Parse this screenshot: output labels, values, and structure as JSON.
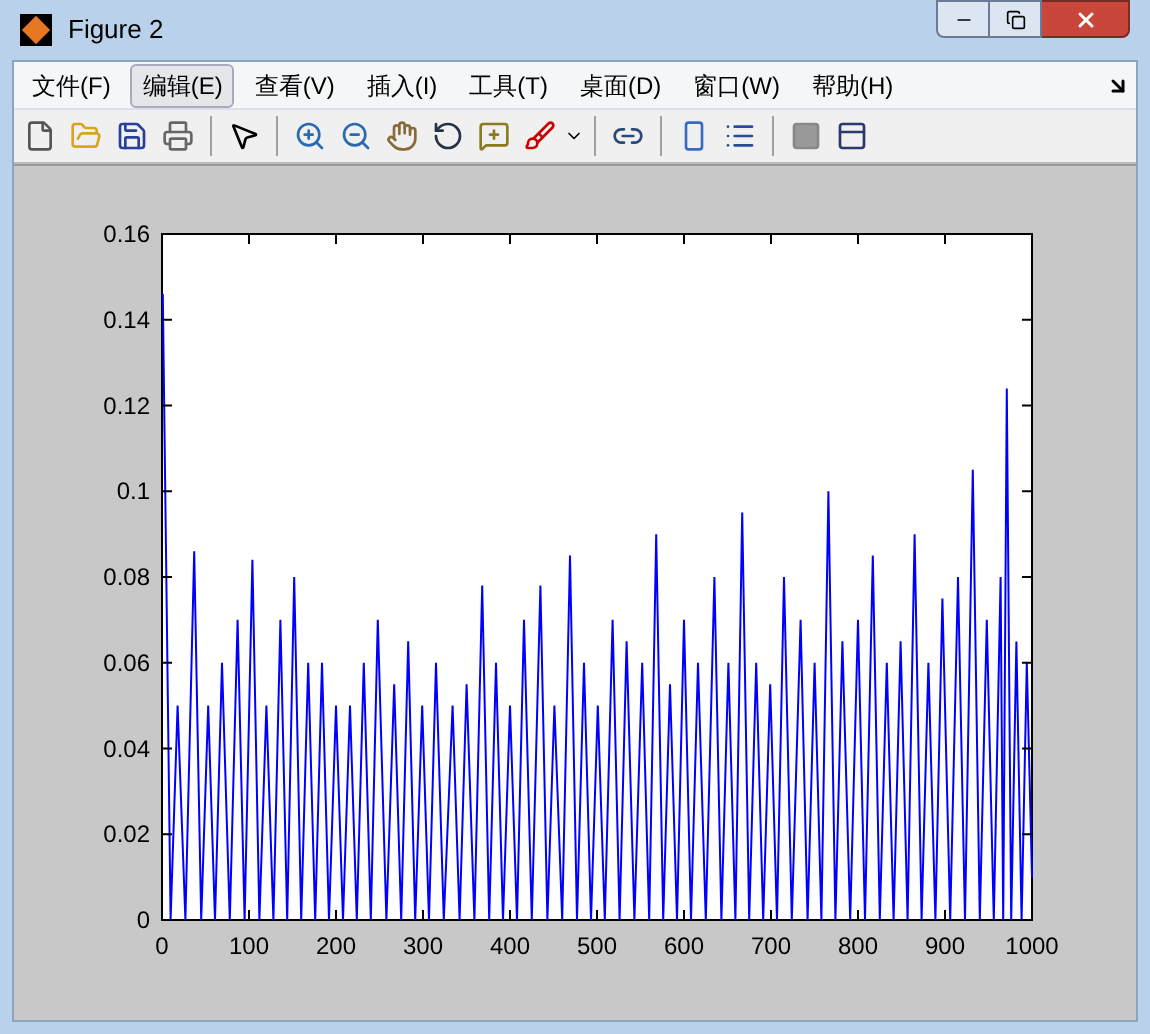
{
  "window": {
    "title": "Figure 2"
  },
  "menu": [
    {
      "label": "文件(F)",
      "selected": false
    },
    {
      "label": "编辑(E)",
      "selected": true
    },
    {
      "label": "查看(V)",
      "selected": false
    },
    {
      "label": "插入(I)",
      "selected": false
    },
    {
      "label": "工具(T)",
      "selected": false
    },
    {
      "label": "桌面(D)",
      "selected": false
    },
    {
      "label": "窗口(W)",
      "selected": false
    },
    {
      "label": "帮助(H)",
      "selected": false
    }
  ],
  "chart_data": {
    "type": "line",
    "xlim": [
      0,
      1000
    ],
    "ylim": [
      0,
      0.16
    ],
    "xticks": [
      0,
      100,
      200,
      300,
      400,
      500,
      600,
      700,
      800,
      900,
      1000
    ],
    "yticks": [
      0,
      0.02,
      0.04,
      0.06,
      0.08,
      0.1,
      0.12,
      0.14,
      0.16
    ],
    "x": [
      1,
      10,
      18,
      27,
      37,
      45,
      53,
      61,
      69,
      78,
      87,
      95,
      104,
      112,
      120,
      128,
      136,
      144,
      152,
      160,
      168,
      176,
      184,
      192,
      200,
      208,
      216,
      224,
      232,
      240,
      248,
      258,
      267,
      275,
      283,
      291,
      299,
      307,
      315,
      324,
      334,
      342,
      350,
      359,
      368,
      376,
      384,
      392,
      400,
      408,
      416,
      425,
      435,
      443,
      451,
      460,
      469,
      477,
      485,
      493,
      501,
      509,
      518,
      526,
      534,
      543,
      552,
      560,
      568,
      576,
      584,
      592,
      600,
      608,
      616,
      625,
      635,
      643,
      651,
      659,
      667,
      675,
      683,
      691,
      699,
      707,
      715,
      724,
      734,
      742,
      750,
      758,
      766,
      774,
      782,
      791,
      800,
      808,
      817,
      825,
      833,
      841,
      849,
      857,
      865,
      873,
      881,
      889,
      897,
      906,
      915,
      923,
      932,
      940,
      948,
      956,
      964,
      967,
      971,
      976,
      982,
      988,
      994,
      1000
    ],
    "series": [
      {
        "color": "#0000ff",
        "values": [
          0.146,
          0,
          0.05,
          0,
          0.086,
          0,
          0.05,
          0,
          0.06,
          0,
          0.07,
          0,
          0.084,
          0,
          0.05,
          0,
          0.07,
          0,
          0.08,
          0,
          0.06,
          0,
          0.06,
          0,
          0.05,
          0,
          0.05,
          0,
          0.06,
          0,
          0.07,
          0,
          0.055,
          0,
          0.065,
          0,
          0.05,
          0,
          0.06,
          0,
          0.05,
          0,
          0.055,
          0,
          0.078,
          0,
          0.06,
          0,
          0.05,
          0,
          0.07,
          0,
          0.078,
          0,
          0.05,
          0,
          0.085,
          0,
          0.06,
          0,
          0.05,
          0,
          0.07,
          0,
          0.065,
          0,
          0.06,
          0,
          0.09,
          0,
          0.055,
          0,
          0.07,
          0,
          0.06,
          0,
          0.08,
          0,
          0.06,
          0,
          0.095,
          0,
          0.06,
          0,
          0.055,
          0,
          0.08,
          0,
          0.07,
          0,
          0.06,
          0,
          0.1,
          0,
          0.065,
          0,
          0.07,
          0,
          0.085,
          0,
          0.06,
          0,
          0.065,
          0,
          0.09,
          0,
          0.06,
          0,
          0.075,
          0,
          0.08,
          0,
          0.105,
          0,
          0.07,
          0,
          0.08,
          0,
          0.124,
          0,
          0.065,
          0,
          0.06,
          0.01
        ]
      }
    ]
  }
}
